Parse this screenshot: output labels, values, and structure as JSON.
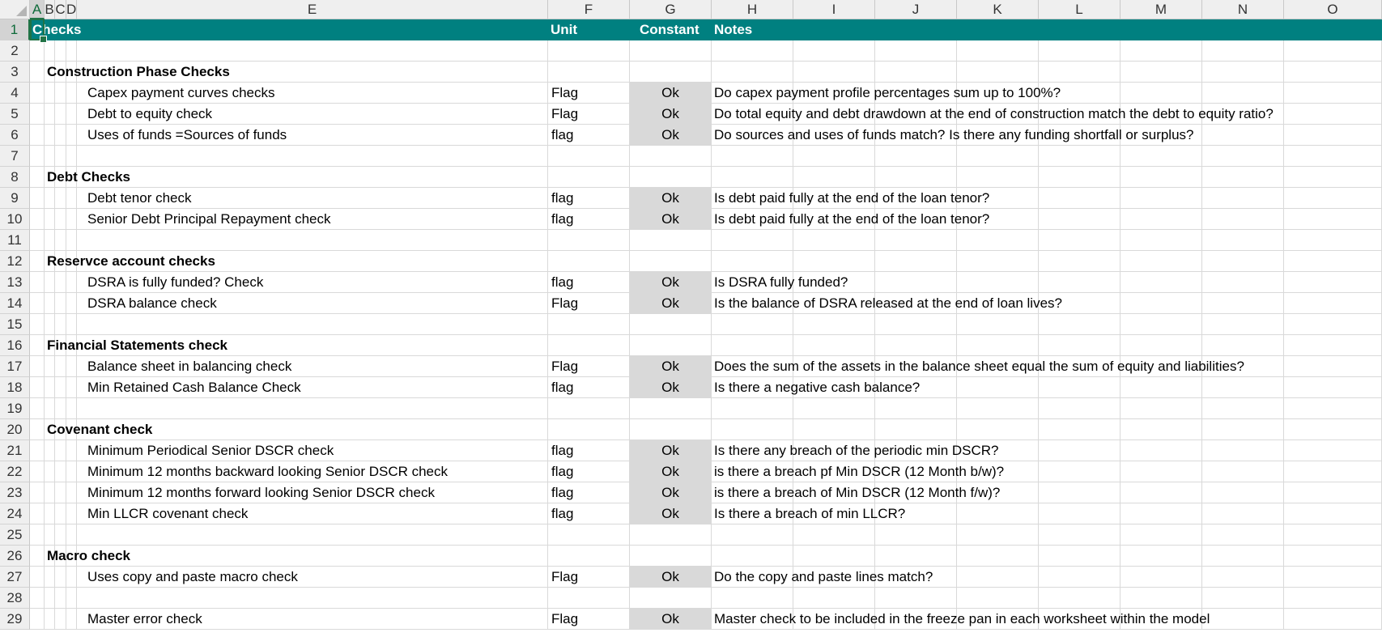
{
  "columns": [
    "A",
    "B",
    "C",
    "D",
    "E",
    "F",
    "G",
    "H",
    "I",
    "J",
    "K",
    "L",
    "M",
    "N",
    "O"
  ],
  "rows": [
    "1",
    "2",
    "3",
    "4",
    "5",
    "6",
    "7",
    "8",
    "9",
    "10",
    "11",
    "12",
    "13",
    "14",
    "15",
    "16",
    "17",
    "18",
    "19",
    "20",
    "21",
    "22",
    "23",
    "24",
    "25",
    "26",
    "27",
    "28",
    "29"
  ],
  "header": {
    "title": "Checks",
    "unit": "Unit",
    "constant": "Constant",
    "notes": "Notes"
  },
  "band_color": "#008080",
  "status_fill_color": "#d9d9d9",
  "selection_color": "#217346",
  "lines": [
    {
      "row": 3,
      "kind": "section",
      "label": "Construction Phase Checks"
    },
    {
      "row": 4,
      "kind": "check",
      "label": "Capex payment curves checks",
      "unit": "Flag",
      "status": "Ok",
      "note": "Do capex payment profile percentages sum up to 100%?"
    },
    {
      "row": 5,
      "kind": "check",
      "label": "Debt to equity check",
      "unit": "Flag",
      "status": "Ok",
      "note": "Do total equity and debt drawdown at the end of construction match the debt to equity ratio?"
    },
    {
      "row": 6,
      "kind": "check",
      "label": "Uses of funds =Sources of funds",
      "unit": "flag",
      "status": "Ok",
      "note": "Do sources and uses of funds match? Is there any funding shortfall or surplus?"
    },
    {
      "row": 8,
      "kind": "section",
      "label": "Debt Checks"
    },
    {
      "row": 9,
      "kind": "check",
      "label": "Debt tenor check",
      "unit": "flag",
      "status": "Ok",
      "note": "Is debt paid fully at the end of the loan tenor?"
    },
    {
      "row": 10,
      "kind": "check",
      "label": "Senior Debt  Principal Repayment  check",
      "unit": "flag",
      "status": "Ok",
      "note": "Is debt paid fully at the end of the loan tenor?"
    },
    {
      "row": 12,
      "kind": "section",
      "label": "Reservce account checks"
    },
    {
      "row": 13,
      "kind": "check",
      "label": "DSRA is fully funded? Check",
      "unit": "flag",
      "status": "Ok",
      "note": "Is DSRA fully funded?"
    },
    {
      "row": 14,
      "kind": "check",
      "label": "DSRA balance check",
      "unit": "Flag",
      "status": "Ok",
      "note": "Is the balance of DSRA released at the end of loan lives?"
    },
    {
      "row": 16,
      "kind": "section",
      "label": "Financial Statements check"
    },
    {
      "row": 17,
      "kind": "check",
      "label": "Balance sheet in balancing check",
      "unit": "Flag",
      "status": "Ok",
      "note": "Does the sum of the assets in the balance sheet equal the sum of equity and liabilities?"
    },
    {
      "row": 18,
      "kind": "check",
      "label": "Min Retained Cash Balance Check",
      "unit": "flag",
      "status": "Ok",
      "note": "Is there a negative cash balance?"
    },
    {
      "row": 20,
      "kind": "section",
      "label": "Covenant check"
    },
    {
      "row": 21,
      "kind": "check",
      "label": "Minimum  Periodical Senior DSCR check",
      "unit": "flag",
      "status": "Ok",
      "note": "Is there any breach of the periodic min DSCR?"
    },
    {
      "row": 22,
      "kind": "check",
      "label": "Minimum  12 months backward looking Senior DSCR check",
      "unit": "flag",
      "status": "Ok",
      "note": "is there a breach pf Min DSCR (12 Month b/w)?"
    },
    {
      "row": 23,
      "kind": "check",
      "label": "Minimum  12 months forward looking Senior DSCR check",
      "unit": "flag",
      "status": "Ok",
      "note": "is there a breach of Min DSCR (12 Month f/w)?"
    },
    {
      "row": 24,
      "kind": "check",
      "label": "Min LLCR covenant check",
      "unit": "flag",
      "status": "Ok",
      "note": "Is there a breach of min LLCR?"
    },
    {
      "row": 26,
      "kind": "section",
      "label": "Macro check"
    },
    {
      "row": 27,
      "kind": "check",
      "label": " Uses copy and paste macro check",
      "unit": "Flag",
      "status": "Ok",
      "note": "Do the copy and paste lines match?"
    },
    {
      "row": 29,
      "kind": "check",
      "label": "Master error check",
      "unit": "Flag",
      "status": "Ok",
      "note": "Master check to be included in the freeze pan in each worksheet within the model"
    }
  ]
}
